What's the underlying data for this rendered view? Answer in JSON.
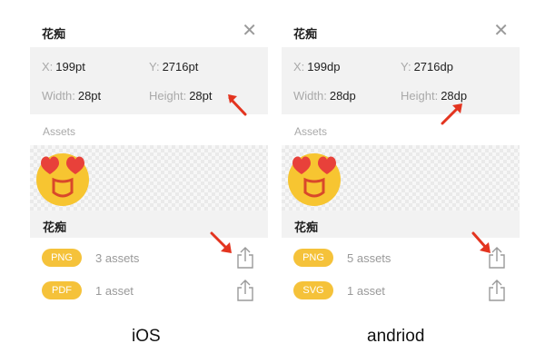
{
  "colors": {
    "badge": "#f5c23a",
    "arrow": "#e3341f",
    "panel_bg": "#f2f2f2"
  },
  "ios": {
    "title": "花痴",
    "close_icon": "close-icon",
    "x_label": "X:",
    "x_value": "199pt",
    "y_label": "Y:",
    "y_value": "2716pt",
    "width_label": "Width:",
    "width_value": "28pt",
    "height_label": "Height:",
    "height_value": "28pt",
    "assets_label": "Assets",
    "asset_name": "花痴",
    "rows": [
      {
        "format": "PNG",
        "count": "3 assets",
        "icon": "share-icon"
      },
      {
        "format": "PDF",
        "count": "1 asset",
        "icon": "share-icon"
      }
    ],
    "caption": "iOS"
  },
  "android": {
    "title": "花痴",
    "close_icon": "close-icon",
    "x_label": "X:",
    "x_value": "199dp",
    "y_label": "Y:",
    "y_value": "2716dp",
    "width_label": "Width:",
    "width_value": "28dp",
    "height_label": "Height:",
    "height_value": "28dp",
    "assets_label": "Assets",
    "asset_name": "花痴",
    "rows": [
      {
        "format": "PNG",
        "count": "5 assets",
        "icon": "share-icon"
      },
      {
        "format": "SVG",
        "count": "1 asset",
        "icon": "share-icon"
      }
    ],
    "caption": "andriod"
  }
}
